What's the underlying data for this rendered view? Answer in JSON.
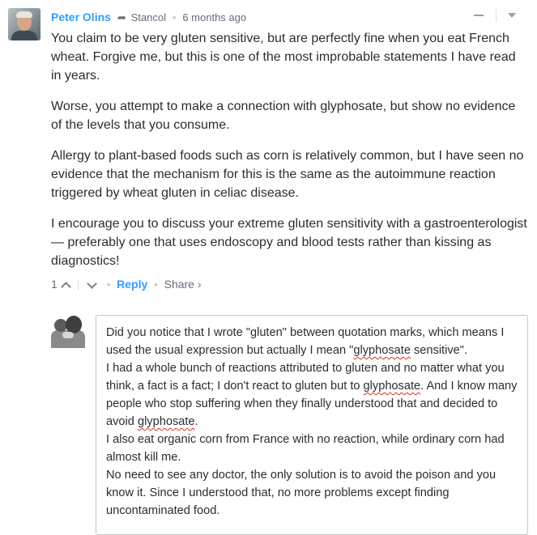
{
  "comment": {
    "author": "Peter Olins",
    "reply_arrow": "➦",
    "reply_to": "Stancol",
    "bullet": "•",
    "time": "6 months ago",
    "paragraphs": [
      "You claim to be very gluten sensitive, but are perfectly fine when you eat French wheat. Forgive me, but this is one of the most improbable statements I have read in years.",
      "Worse, you attempt to make a connection with glyphosate, but show no evidence of the levels that you consume.",
      "Allergy to plant-based foods such as corn is relatively common, but I have seen no evidence that the mechanism for this is the same as the autoimmune reaction triggered by wheat gluten in celiac disease.",
      "I encourage you to discuss your extreme gluten sensitivity with a gastroenterologist — preferably one that uses endoscopy and blood tests rather than kissing as diagnostics!"
    ],
    "footer": {
      "vote_count": "1",
      "dot": "•",
      "reply_label": "Reply",
      "share_label": "Share ›"
    }
  },
  "reply_editor": {
    "line1": "Did you notice that I wrote \"gluten\" between quotation marks, which means I used the usual expression but actually I mean \"",
    "line1_spell": "glyphosate",
    "line1_end": " sensitive\".",
    "line2_start": "I had a whole bunch of reactions attributed to gluten and no matter what you think, a fact is a fact; I don't react to gluten but to ",
    "line2_spell": "glyphosate",
    "line2_mid": ". And I know many people who stop suffering when they finally understood that and decided to avoid ",
    "line2_spell2": "glyphosate",
    "line2_end": ".",
    "line3": "I also eat organic corn from France with no reaction, while ordinary corn had almost kill me.",
    "line4": "No need to see any doctor, the only solution is to avoid the poison and you know it. Since I understood that, no more problems except finding uncontaminated food."
  }
}
